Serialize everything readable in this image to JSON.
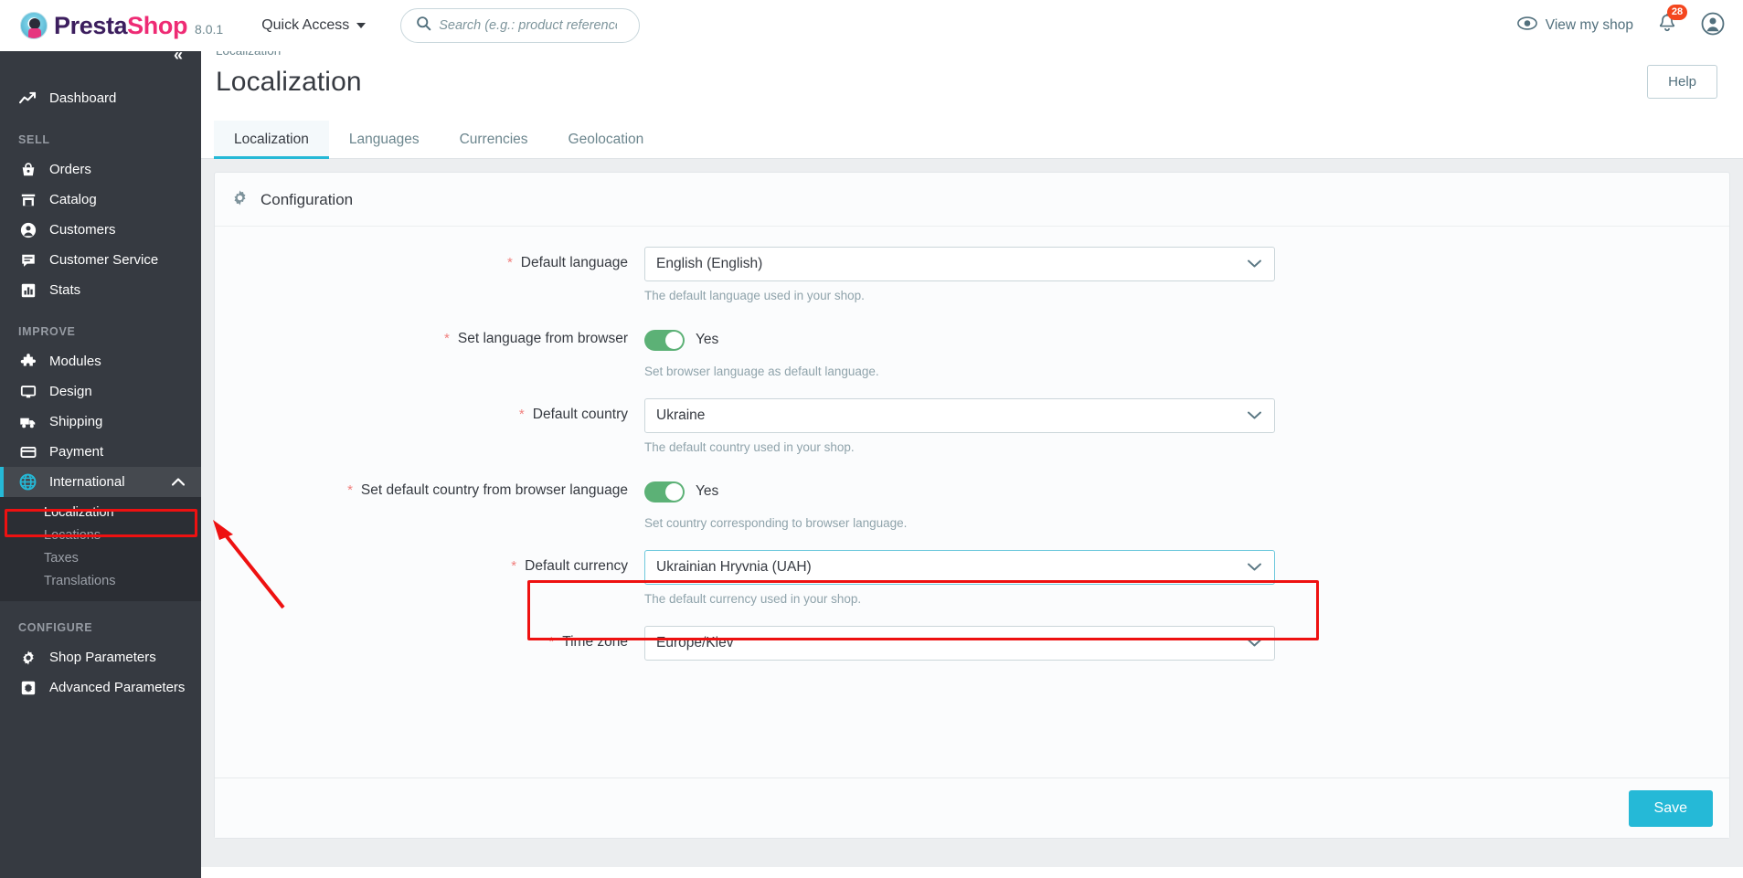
{
  "header": {
    "brand_presta": "Presta",
    "brand_shop": "Shop",
    "version": "8.0.1",
    "quick_access": "Quick Access",
    "search_placeholder": "Search (e.g.: product reference, customer name)",
    "search_value": "",
    "view_my_shop": "View my shop",
    "notification_count": "28"
  },
  "sidebar": {
    "dashboard": "Dashboard",
    "sections": [
      {
        "title": "SELL",
        "items": [
          {
            "label": "Orders",
            "icon": "basket-icon"
          },
          {
            "label": "Catalog",
            "icon": "store-icon"
          },
          {
            "label": "Customers",
            "icon": "user-circle-icon"
          },
          {
            "label": "Customer Service",
            "icon": "chat-icon"
          },
          {
            "label": "Stats",
            "icon": "bar-chart-icon"
          }
        ]
      },
      {
        "title": "IMPROVE",
        "items": [
          {
            "label": "Modules",
            "icon": "puzzle-icon"
          },
          {
            "label": "Design",
            "icon": "monitor-icon"
          },
          {
            "label": "Shipping",
            "icon": "truck-icon"
          },
          {
            "label": "Payment",
            "icon": "credit-card-icon"
          },
          {
            "label": "International",
            "icon": "globe-icon"
          }
        ]
      },
      {
        "title": "CONFIGURE",
        "items": [
          {
            "label": "Shop Parameters",
            "icon": "gear-icon"
          },
          {
            "label": "Advanced Parameters",
            "icon": "sliders-icon"
          }
        ]
      }
    ],
    "international_submenu": [
      {
        "label": "Localization",
        "current": true
      },
      {
        "label": "Locations",
        "current": false
      },
      {
        "label": "Taxes",
        "current": false
      },
      {
        "label": "Translations",
        "current": false
      }
    ]
  },
  "page": {
    "breadcrumb": "Localization",
    "title": "Localization",
    "help_label": "Help",
    "tabs": [
      {
        "label": "Localization",
        "active": true
      },
      {
        "label": "Languages",
        "active": false
      },
      {
        "label": "Currencies",
        "active": false
      },
      {
        "label": "Geolocation",
        "active": false
      }
    ]
  },
  "configuration": {
    "card_title": "Configuration",
    "save_label": "Save",
    "fields": {
      "default_language": {
        "label": "Default language",
        "value": "English (English)",
        "help": "The default language used in your shop.",
        "required": "*"
      },
      "set_language_from_browser": {
        "label": "Set language from browser",
        "value": "Yes",
        "help": "Set browser language as default language.",
        "required": "*"
      },
      "default_country": {
        "label": "Default country",
        "value": "Ukraine",
        "help": "The default country used in your shop.",
        "required": "*"
      },
      "set_country_from_browser": {
        "label": "Set default country from browser language",
        "value": "Yes",
        "help": "Set country corresponding to browser language.",
        "required": "*"
      },
      "default_currency": {
        "label": "Default currency",
        "value": "Ukrainian Hryvnia (UAH)",
        "help": "The default currency used in your shop.",
        "required": "*"
      },
      "time_zone": {
        "label": "Time zone",
        "value": "Europe/Kiev",
        "help": "",
        "required": "*"
      }
    }
  },
  "colors": {
    "accent": "#25b9d7",
    "annotation": "#ee1111",
    "toggle_on": "#5cb176",
    "sidebar": "#363a41",
    "brand_pink": "#ee2b74",
    "badge_red": "#f4461e"
  }
}
